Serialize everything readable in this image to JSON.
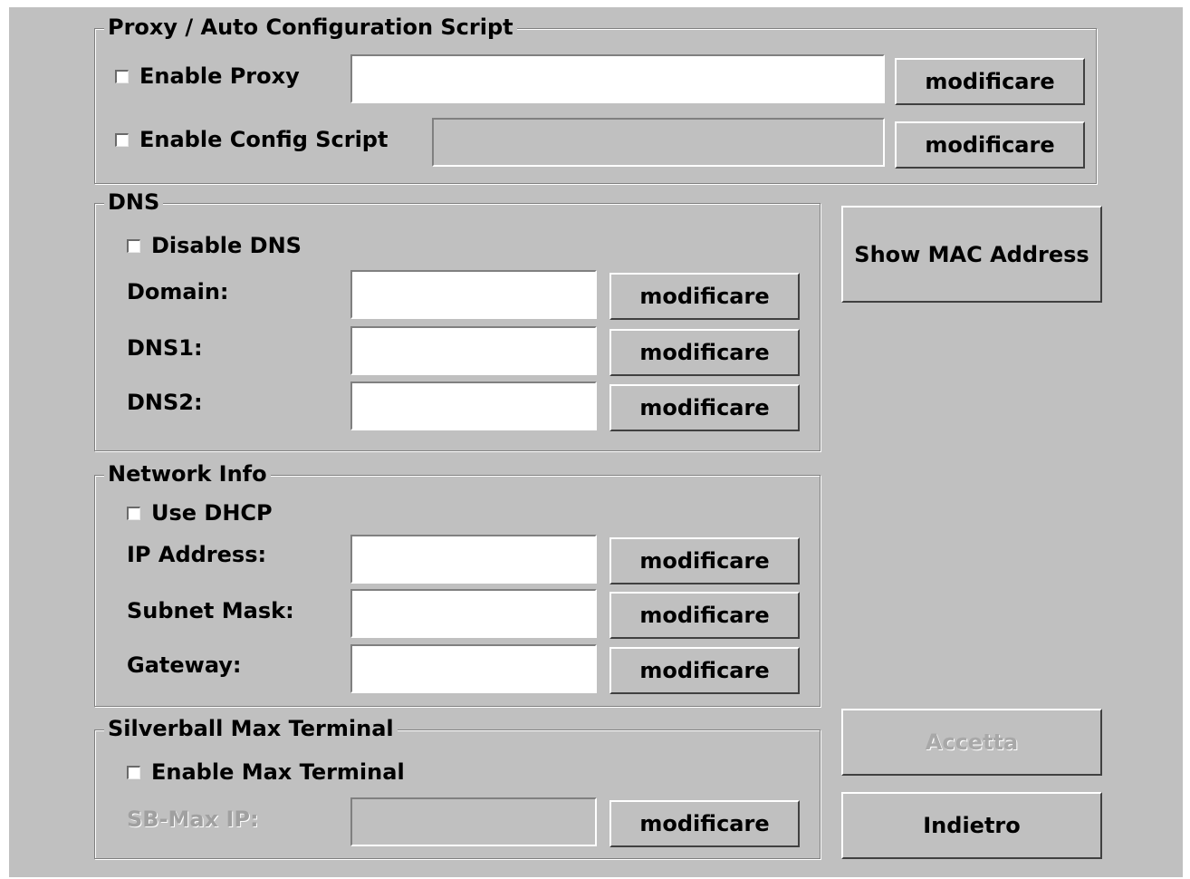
{
  "proxy_group": {
    "title": "Proxy / Auto Configuration Script",
    "enable_proxy": {
      "label": "Enable Proxy",
      "checked": false,
      "value": "",
      "button": "modificare"
    },
    "enable_config_script": {
      "label": "Enable Config Script",
      "checked": false,
      "value": "",
      "button": "modificare"
    }
  },
  "dns_group": {
    "title": "DNS",
    "disable_dns": {
      "label": "Disable DNS",
      "checked": false
    },
    "domain": {
      "label": "Domain:",
      "value": "",
      "button": "modificare"
    },
    "dns1": {
      "label": "DNS1:",
      "value": "",
      "button": "modificare"
    },
    "dns2": {
      "label": "DNS2:",
      "value": "",
      "button": "modificare"
    }
  },
  "network_group": {
    "title": "Network Info",
    "use_dhcp": {
      "label": "Use DHCP",
      "checked": false
    },
    "ip_address": {
      "label": "IP Address:",
      "value": "",
      "button": "modificare"
    },
    "subnet_mask": {
      "label": "Subnet Mask:",
      "value": "",
      "button": "modificare"
    },
    "gateway": {
      "label": "Gateway:",
      "value": "",
      "button": "modificare"
    }
  },
  "terminal_group": {
    "title": "Silverball Max Terminal",
    "enable_max_terminal": {
      "label": "Enable Max Terminal",
      "checked": false
    },
    "sb_max_ip": {
      "label": "SB-Max IP:",
      "value": "",
      "button": "modificare"
    }
  },
  "actions": {
    "show_mac": "Show MAC Address",
    "accept": "Accetta",
    "back": "Indietro"
  },
  "colors": {
    "panel": "#c0c0c0",
    "field": "#ffffff",
    "disabled_text": "#a0a0a0"
  }
}
